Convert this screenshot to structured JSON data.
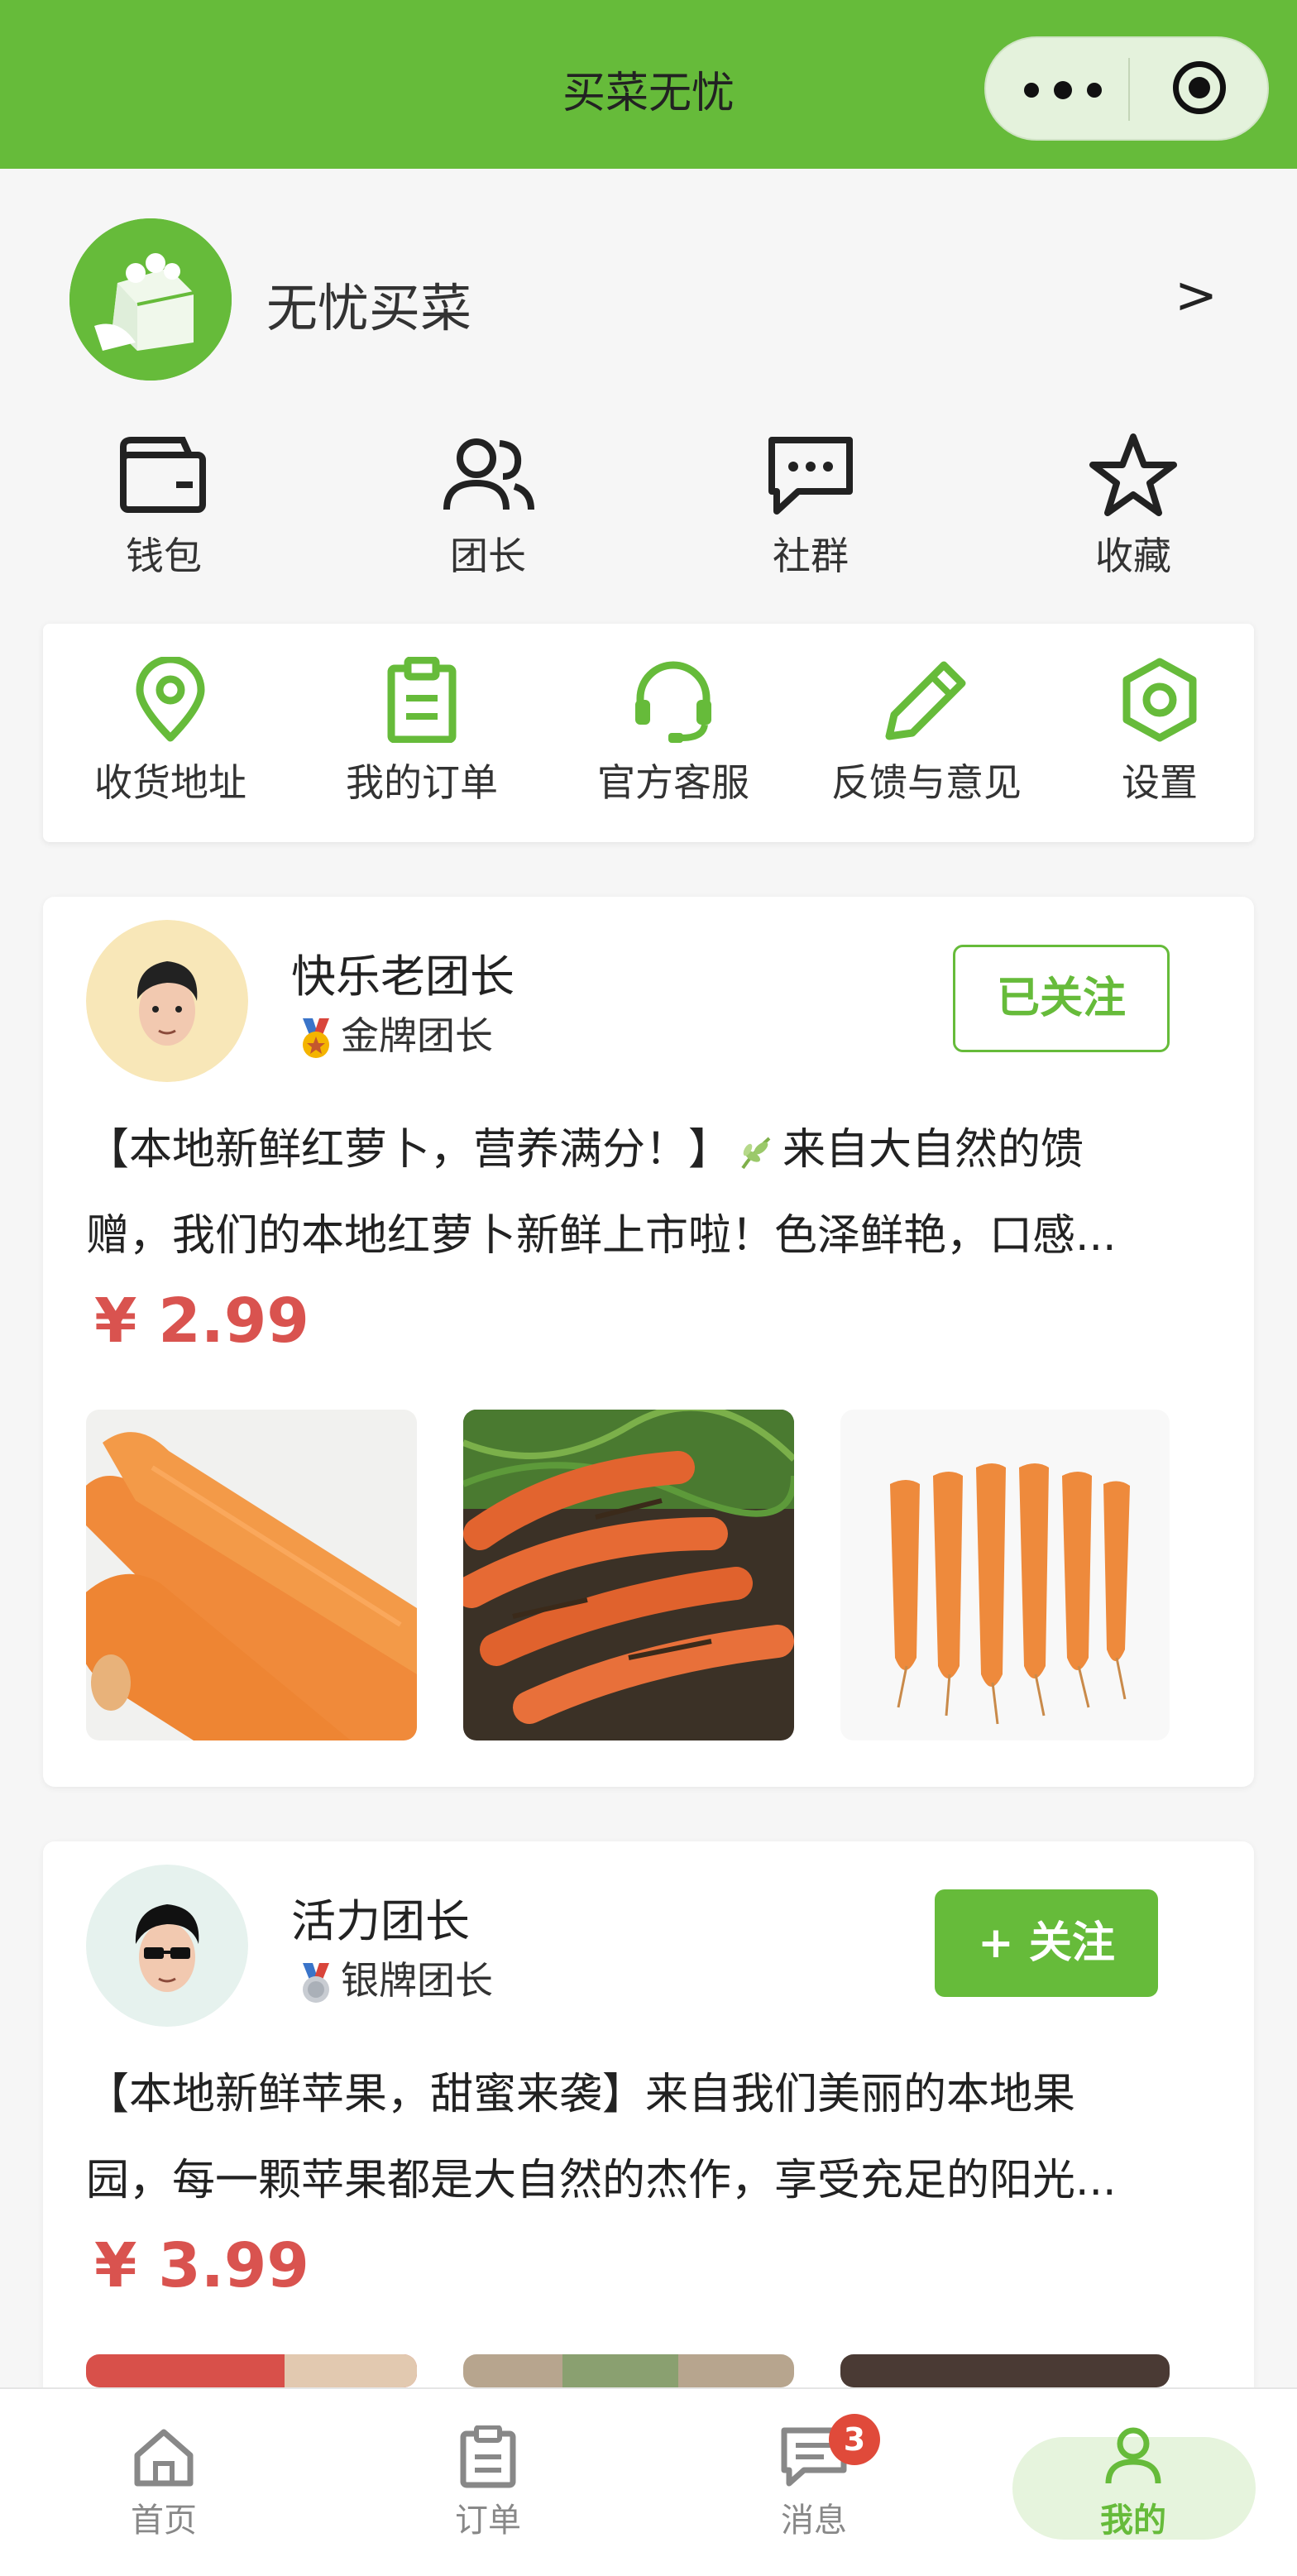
{
  "header": {
    "title": "买菜无忧"
  },
  "profile": {
    "name": "无忧买菜",
    "arrow": ">",
    "quick_links": [
      {
        "label": "钱包",
        "icon": "wallet-icon"
      },
      {
        "label": "团长",
        "icon": "users-icon"
      },
      {
        "label": "社群",
        "icon": "chat-icon"
      },
      {
        "label": "收藏",
        "icon": "star-icon"
      }
    ]
  },
  "services": [
    {
      "label": "收货地址",
      "icon": "location-icon"
    },
    {
      "label": "我的订单",
      "icon": "clipboard-icon"
    },
    {
      "label": "官方客服",
      "icon": "headset-icon"
    },
    {
      "label": "反馈与意见",
      "icon": "pencil-icon"
    },
    {
      "label": "设置",
      "icon": "settings-icon"
    }
  ],
  "posts": [
    {
      "leader_name": "快乐老团长",
      "rank": "金牌团长",
      "follow_label": "已关注",
      "followed": true,
      "desc_part1": "【本地新鲜红萝卜，营养满分！】",
      "desc_part2": "来自大自然的馈",
      "desc_line2": "赠，我们的本地红萝卜新鲜上市啦！色泽鲜艳，口感...",
      "price": "¥ 2.99"
    },
    {
      "leader_name": "活力团长",
      "rank": "银牌团长",
      "follow_label": "+ 关注",
      "followed": false,
      "desc_line1": "【本地新鲜苹果，甜蜜来袭】来自我们美丽的本地果",
      "desc_line2": "园，每一颗苹果都是大自然的杰作，享受充足的阳光...",
      "price": "¥ 3.99"
    }
  ],
  "tabbar": {
    "items": [
      {
        "label": "首页",
        "icon": "home-icon"
      },
      {
        "label": "订单",
        "icon": "clipboard-icon"
      },
      {
        "label": "消息",
        "icon": "message-icon"
      },
      {
        "label": "我的",
        "icon": "user-icon"
      }
    ],
    "active": "我的",
    "message_badge": "3"
  },
  "colors": {
    "primary": "#66bb3a",
    "price": "#d9534f",
    "badge": "#e04a3a"
  }
}
